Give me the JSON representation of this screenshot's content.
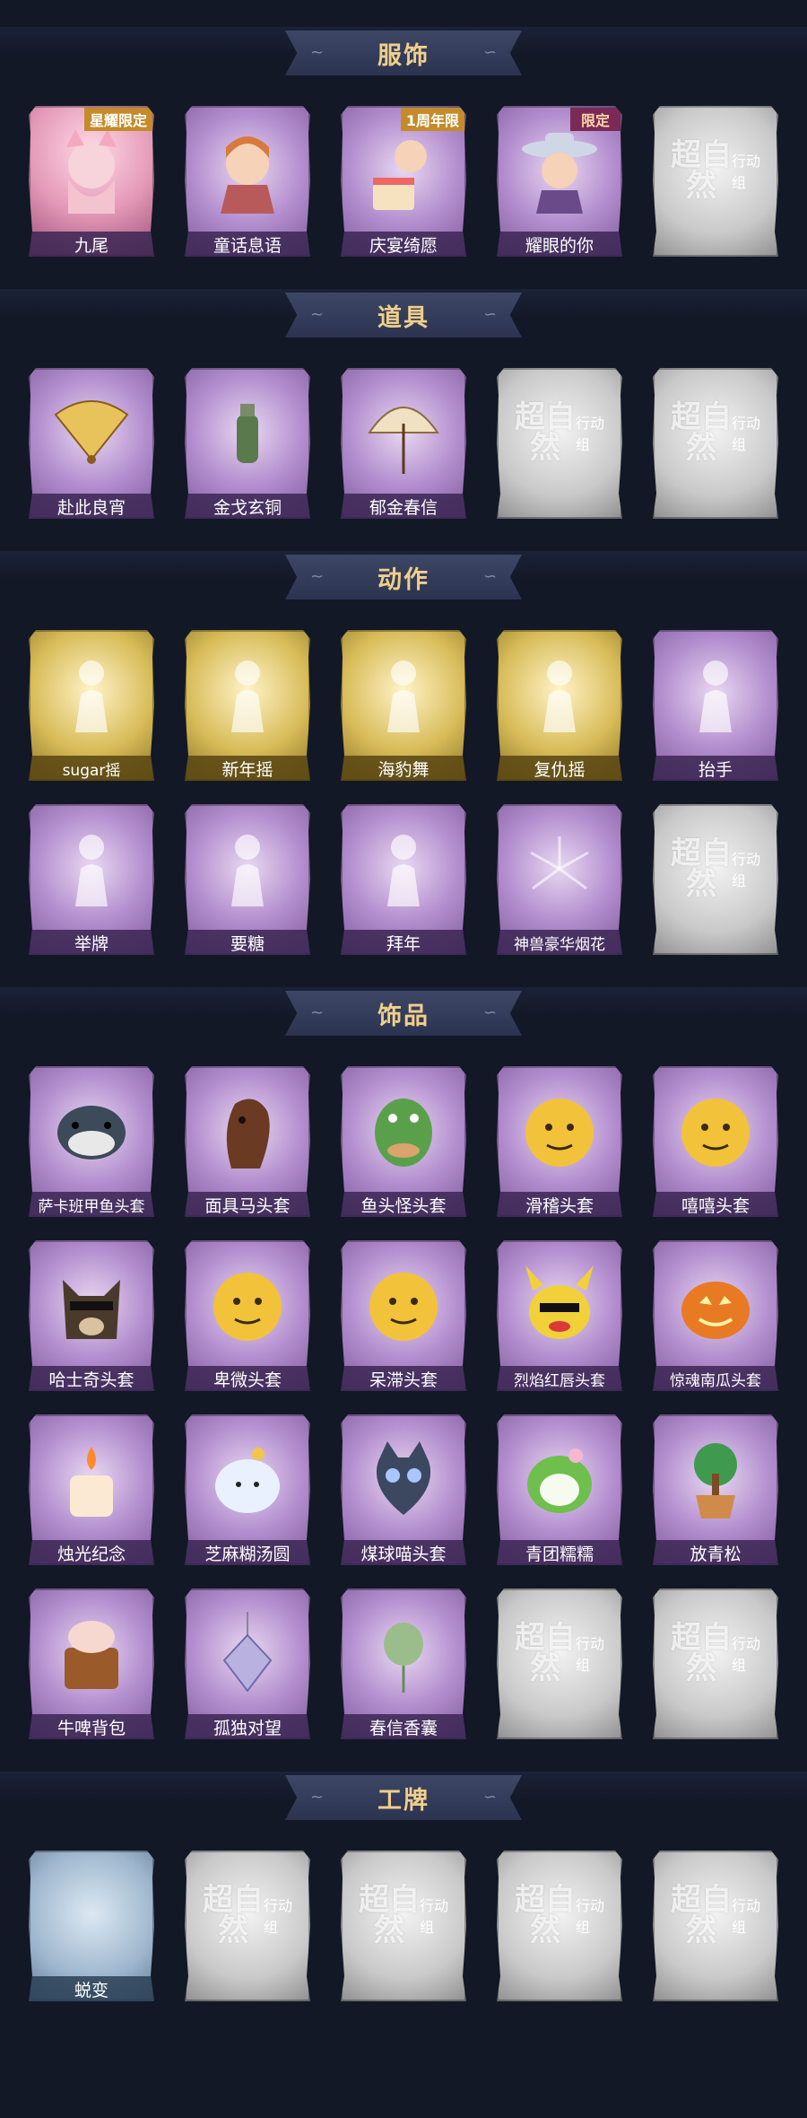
{
  "sections": [
    {
      "title": "服饰",
      "rows": [
        [
          {
            "label": "九尾",
            "tone": "pink",
            "art": "fox-girl-icon",
            "badge": "星耀限定"
          },
          {
            "label": "童话息语",
            "tone": "purple",
            "art": "fairytale-girl-icon"
          },
          {
            "label": "庆宴绮愿",
            "tone": "purple",
            "art": "birthday-girl-icon",
            "badge": "1周年限"
          },
          {
            "label": "耀眼的你",
            "tone": "purple",
            "art": "cowgirl-icon",
            "badge": "限定"
          },
          {
            "label": "",
            "tone": "gray",
            "ghost": "超自然",
            "ghost_sub": "行动组"
          }
        ]
      ]
    },
    {
      "title": "道具",
      "rows": [
        [
          {
            "label": "赴此良宵",
            "tone": "purple",
            "art": "fan-icon"
          },
          {
            "label": "金戈玄铜",
            "tone": "purple",
            "art": "grenade-icon"
          },
          {
            "label": "郁金春信",
            "tone": "purple",
            "art": "umbrella-icon"
          },
          {
            "label": "",
            "tone": "gray",
            "ghost": "超自然",
            "ghost_sub": "行动组"
          },
          {
            "label": "",
            "tone": "gray",
            "ghost": "超自然",
            "ghost_sub": "行动组"
          }
        ]
      ]
    },
    {
      "title": "动作",
      "rows": [
        [
          {
            "label": "sugar摇",
            "tone": "gold",
            "art": "dance-pose-icon"
          },
          {
            "label": "新年摇",
            "tone": "gold",
            "art": "dance-pose-icon"
          },
          {
            "label": "海豹舞",
            "tone": "gold",
            "art": "dance-pose-icon"
          },
          {
            "label": "复仇摇",
            "tone": "gold",
            "art": "dance-pose-icon"
          },
          {
            "label": "抬手",
            "tone": "purple",
            "art": "raise-hand-icon"
          }
        ],
        [
          {
            "label": "举牌",
            "tone": "purple",
            "art": "sign-hold-icon"
          },
          {
            "label": "要糖",
            "tone": "purple",
            "art": "ask-candy-icon"
          },
          {
            "label": "拜年",
            "tone": "purple",
            "art": "new-year-greet-icon"
          },
          {
            "label": "神兽豪华烟花",
            "tone": "purple",
            "art": "fireworks-icon"
          },
          {
            "label": "",
            "tone": "gray",
            "ghost": "超自然",
            "ghost_sub": "行动组"
          }
        ]
      ]
    },
    {
      "title": "饰品",
      "rows": [
        [
          {
            "label": "萨卡班甲鱼头套",
            "tone": "purple",
            "art": "fish-head-icon"
          },
          {
            "label": "面具马头套",
            "tone": "purple",
            "art": "horse-head-icon"
          },
          {
            "label": "鱼头怪头套",
            "tone": "purple",
            "art": "fish-monster-icon"
          },
          {
            "label": "滑稽头套",
            "tone": "purple",
            "art": "funny-face-icon"
          },
          {
            "label": "嘻嘻头套",
            "tone": "purple",
            "art": "grin-face-icon"
          }
        ],
        [
          {
            "label": "哈士奇头套",
            "tone": "purple",
            "art": "husky-head-icon"
          },
          {
            "label": "卑微头套",
            "tone": "purple",
            "art": "humble-face-icon"
          },
          {
            "label": "呆滞头套",
            "tone": "purple",
            "art": "dazed-face-icon"
          },
          {
            "label": "烈焰红唇头套",
            "tone": "purple",
            "art": "pikachu-head-icon"
          },
          {
            "label": "惊魂南瓜头套",
            "tone": "purple",
            "art": "pumpkin-head-icon"
          }
        ],
        [
          {
            "label": "烛光纪念",
            "tone": "purple",
            "art": "candle-icon"
          },
          {
            "label": "芝麻糊汤圆",
            "tone": "purple",
            "art": "tangyuan-icon"
          },
          {
            "label": "煤球喵头套",
            "tone": "purple",
            "art": "cat-head-icon"
          },
          {
            "label": "青团糯糯",
            "tone": "purple",
            "art": "qingtuan-icon"
          },
          {
            "label": "放青松",
            "tone": "purple",
            "art": "bonsai-icon"
          }
        ],
        [
          {
            "label": "牛啤背包",
            "tone": "purple",
            "art": "beer-cow-backpack-icon"
          },
          {
            "label": "孤独对望",
            "tone": "purple",
            "art": "charm-pendant-icon"
          },
          {
            "label": "春信香囊",
            "tone": "purple",
            "art": "sachet-icon"
          },
          {
            "label": "",
            "tone": "gray",
            "ghost": "超自然",
            "ghost_sub": "行动组"
          },
          {
            "label": "",
            "tone": "gray",
            "ghost": "超自然",
            "ghost_sub": "行动组"
          }
        ]
      ]
    },
    {
      "title": "工牌",
      "rows": [
        [
          {
            "label": "蜕变",
            "tone": "blue",
            "art": "badge-blank-icon"
          },
          {
            "label": "",
            "tone": "gray",
            "ghost": "超自然",
            "ghost_sub": "行动组"
          },
          {
            "label": "",
            "tone": "gray",
            "ghost": "超自然",
            "ghost_sub": "行动组"
          },
          {
            "label": "",
            "tone": "gray",
            "ghost": "超自然",
            "ghost_sub": "行动组"
          },
          {
            "label": "",
            "tone": "gray",
            "ghost": "超自然",
            "ghost_sub": "行动组"
          }
        ]
      ]
    }
  ],
  "colors": {
    "background": "#121826",
    "banner": "#2b3350",
    "title": "#f1cf8b"
  }
}
